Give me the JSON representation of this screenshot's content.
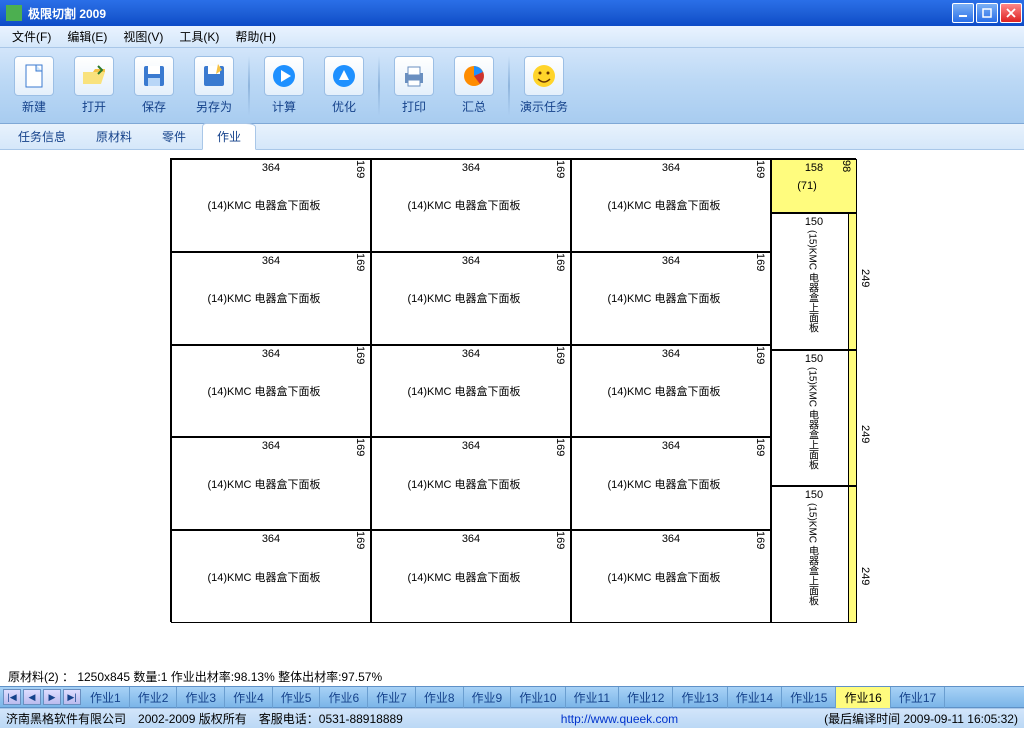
{
  "window": {
    "title": "极限切割 2009"
  },
  "menu": {
    "file": "文件(F)",
    "edit": "编辑(E)",
    "view": "视图(V)",
    "tools": "工具(K)",
    "help": "帮助(H)"
  },
  "toolbar": {
    "new": "新建",
    "open": "打开",
    "save": "保存",
    "saveas": "另存为",
    "calc": "计算",
    "optimize": "优化",
    "print": "打印",
    "summary": "汇总",
    "demo": "演示任务"
  },
  "tabs": {
    "taskinfo": "任务信息",
    "material": "原材料",
    "parts": "零件",
    "job": "作业"
  },
  "layout": {
    "big_w": "364",
    "big_h": "169",
    "big_label": "(14)KMC 电器盒下面板",
    "waste_w": "158",
    "waste_h": "98",
    "waste_label": "(71)",
    "v_w": "150",
    "v_h": "249",
    "v_label": "(15)KMC 电器盒上面板"
  },
  "statusline": "原材料(2) ： 1250x845   数量:1   作业出材率:98.13%   整体出材率:97.57%",
  "jobtabs": {
    "nav_first": "|◀",
    "nav_prev": "◀",
    "nav_next": "▶",
    "nav_last": "▶|",
    "items": [
      "作业1",
      "作业2",
      "作业3",
      "作业4",
      "作业5",
      "作业6",
      "作业7",
      "作业8",
      "作业9",
      "作业10",
      "作业11",
      "作业12",
      "作业13",
      "作业14",
      "作业15",
      "作业16",
      "作业17"
    ],
    "active": 15
  },
  "footer": {
    "company": "济南黑格软件有限公司",
    "copyright": "2002-2009 版权所有",
    "phone_label": "客服电话：",
    "phone": "0531-88918889",
    "url": "http://www.queek.com",
    "compile_label": "(最后编译时间",
    "compile_time": "2009-09-11 16:05:32)"
  }
}
